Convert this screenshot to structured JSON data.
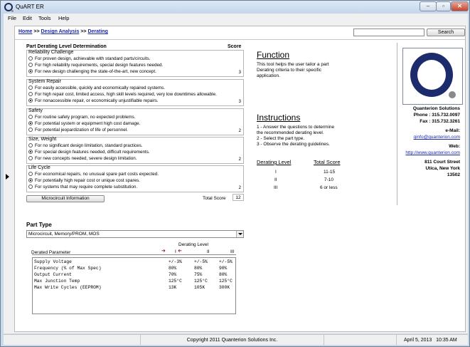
{
  "window": {
    "title": "QuART ER",
    "min": "–",
    "max": "▫",
    "close": "✕"
  },
  "menu": [
    "File",
    "Edit",
    "Tools",
    "Help"
  ],
  "breadcrumb": {
    "home": "Home",
    "sep1": ">>",
    "design": "Design Analysis",
    "sep2": ">>",
    "derating": "Derating"
  },
  "search": {
    "button": "Search",
    "value": ""
  },
  "form": {
    "title": "Part Derating Level Determination",
    "score_header": "Score",
    "groups": [
      {
        "label": "Reliability Challenge",
        "options": [
          "For proven design, achievable with standard parts/circuits.",
          "For high reliability requirements, special design features needed.",
          "For new design challenging the state-of-the-art, new concept."
        ],
        "selected": 2,
        "score": "3"
      },
      {
        "label": "System Repair",
        "options": [
          "For easily accessible, quickly and economically repaired systems.",
          "For high repair cost, limited access, high skill levels required, very low downtimes allowable.",
          "For nonaccessible repair, or economically unjustifiable repairs."
        ],
        "selected": 2,
        "score": "3"
      },
      {
        "label": "Safety",
        "options": [
          "For routine safety program, no expected problems.",
          "For potential system or equipment high cost damage.",
          "For potential jeopardization of life of personnel."
        ],
        "selected": 1,
        "score": "2"
      },
      {
        "label": "Size, Weight",
        "options": [
          "For no significant design limitation, standard practices.",
          "For special design features needed, difficult requirements.",
          "For new concepts needed, severe design limitation."
        ],
        "selected": 1,
        "score": "2"
      },
      {
        "label": "Life Cycle",
        "options": [
          "For economical repairs, no unusual spare part costs expected.",
          "For potentially high repair cost or unique cost spares.",
          "For systems that may require complete substitution."
        ],
        "selected": 1,
        "score": "2"
      }
    ],
    "microcircuit_button": "Microcircuit Information",
    "total_label": "Total Score",
    "total_value": "12",
    "part_type_label": "Part Type",
    "part_type_value": "Microcircuit, Memory/PROM, MOS"
  },
  "derating": {
    "level_header": "Derating Level",
    "param_header": "Derated Parameter",
    "levels": [
      "I",
      "II",
      "III"
    ],
    "rows": [
      {
        "param": "Supply Voltage",
        "v": [
          "+/-3%",
          "+/-5%",
          "+/-5%"
        ]
      },
      {
        "param": "Frequency (% of Max Spec)",
        "v": [
          "80%",
          "80%",
          "90%"
        ]
      },
      {
        "param": "Output Current",
        "v": [
          "70%",
          "75%",
          "80%"
        ]
      },
      {
        "param": "Max Junction Temp",
        "v": [
          "125°C",
          "125°C",
          "125°C"
        ]
      },
      {
        "param": "Max Write Cycles (EEPROM)",
        "v": [
          "13K",
          "105K",
          "300K"
        ]
      }
    ]
  },
  "function": {
    "heading": "Function",
    "text": [
      "This tool helps the user tailor a part",
      "Derating criteria to their specific",
      "application."
    ]
  },
  "instructions": {
    "heading": "Instructions",
    "lines": [
      "1 - Answer the questions to determine",
      "the recommended derating level.",
      "2 - Select the part type.",
      "3 - Observe the derating guidelines."
    ]
  },
  "score_table": {
    "h1": "Derating Level",
    "h2": "Total Score",
    "rows": [
      [
        "I",
        "11-15"
      ],
      [
        "II",
        "7-10"
      ],
      [
        "III",
        "6 or less"
      ]
    ]
  },
  "company": {
    "name": "Quanterion Solutions",
    "phone": "Phone : 315.732.0097",
    "fax": "Fax : 315.732.3261",
    "email_label": "e-Mail:",
    "email": "qinfo@quanterion.com",
    "web_label": "Web:",
    "web": "http://www.quanterion.com",
    "street": "811 Court Street",
    "city": "Utica, New York",
    "zip": "13502"
  },
  "status": {
    "copyright": "Copyright 2011 Quanterion Solutions Inc.",
    "date": "April 5, 2013",
    "time": "10:35 AM"
  }
}
